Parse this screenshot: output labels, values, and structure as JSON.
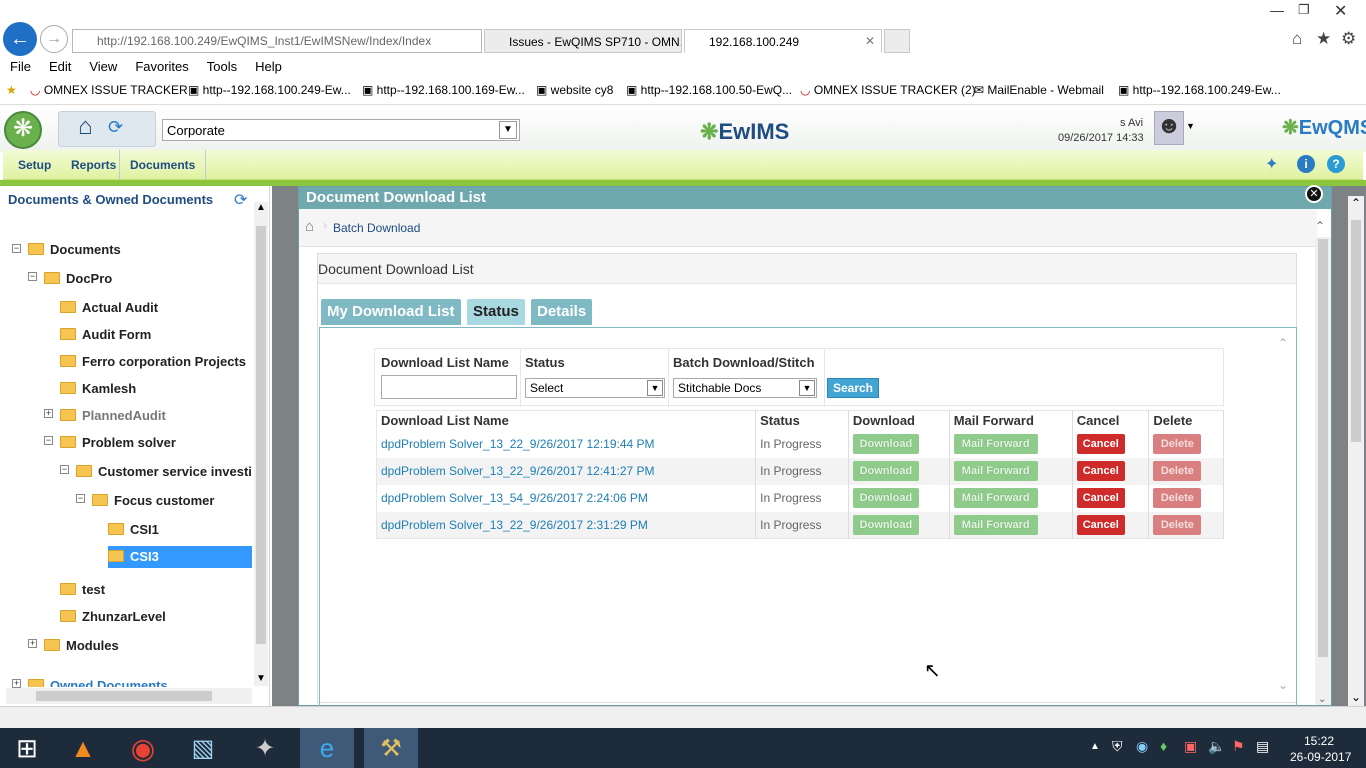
{
  "browser": {
    "url": "http://192.168.100.249/EwQIMS_Inst1/EwIMSNew/Index/Index",
    "tabs": [
      "Issues - EwQIMS SP710 - OMN...",
      "192.168.100.249"
    ],
    "menu": [
      "File",
      "Edit",
      "View",
      "Favorites",
      "Tools",
      "Help"
    ],
    "favorites": [
      "OMNEX ISSUE TRACKER",
      "http--192.168.100.249-Ew...",
      "http--192.168.100.169-Ew...",
      "website cy8",
      "http--192.168.100.50-EwQ...",
      "OMNEX ISSUE TRACKER (2)",
      "MailEnable - Webmail",
      "http--192.168.100.249-Ew..."
    ]
  },
  "app": {
    "site_select": "Corporate",
    "logo": "EwIMS",
    "brand": "EwQMS",
    "user": "s Avi",
    "datetime": "09/26/2017 14:33",
    "nav": [
      "Setup",
      "Reports",
      "Documents"
    ]
  },
  "sidebar": {
    "title": "Documents & Owned Documents",
    "nodes": [
      "Documents",
      "DocPro",
      "Actual Audit",
      "Audit Form",
      "Ferro corporation Projects",
      "Kamlesh",
      "PlannedAudit",
      "Problem solver",
      "Customer service investigat",
      "Focus customer",
      "CSI1",
      "CSI3",
      "test",
      "ZhunzarLevel",
      "Modules",
      "Owned Documents"
    ]
  },
  "modal": {
    "title": "Document Download List",
    "breadcrumb": "Batch Download",
    "panel_title": "Document Download List",
    "tabs": [
      "My Download List",
      "Status",
      "Details"
    ],
    "filter": {
      "name_label": "Download List Name",
      "status_label": "Status",
      "status_value": "Select",
      "batch_label": "Batch Download/Stitch",
      "batch_value": "Stitchable Docs",
      "search_label": "Search"
    },
    "columns": [
      "Download List Name",
      "Status",
      "Download",
      "Mail Forward",
      "Cancel",
      "Delete"
    ],
    "rows": [
      {
        "name": "dpdProblem Solver_13_22_9/26/2017 12:19:44 PM",
        "status": "In Progress"
      },
      {
        "name": "dpdProblem Solver_13_22_9/26/2017 12:41:27 PM",
        "status": "In Progress"
      },
      {
        "name": "dpdProblem Solver_13_54_9/26/2017 2:24:06 PM",
        "status": "In Progress"
      },
      {
        "name": "dpdProblem Solver_13_22_9/26/2017 2:31:29 PM",
        "status": "In Progress"
      }
    ],
    "btn": {
      "download": "Download",
      "mail": "Mail Forward",
      "cancel": "Cancel",
      "delete": "Delete"
    }
  },
  "taskbar": {
    "time": "15:22",
    "date": "26-09-2017"
  },
  "colors": {
    "accent": "#6fa8ad",
    "nav_bg": "#dff2a0",
    "selected": "#3399ff"
  }
}
